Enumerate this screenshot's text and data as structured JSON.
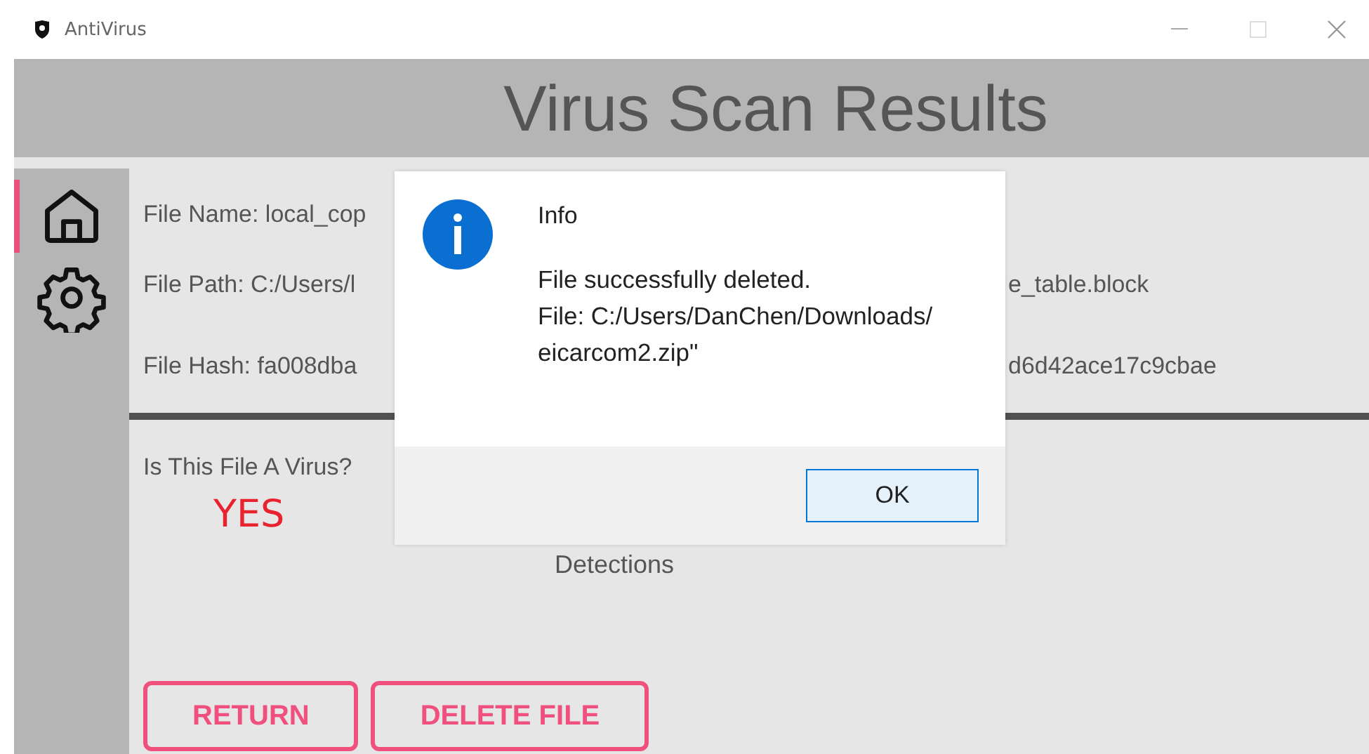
{
  "window": {
    "title": "AntiVirus"
  },
  "header": {
    "title": "Virus Scan Results"
  },
  "sidebar": {
    "items": [
      {
        "kind": "home",
        "selected": true
      },
      {
        "kind": "settings",
        "selected": false
      }
    ]
  },
  "file_info": [
    {
      "label": "File Name:",
      "value_start": "local_cop"
    },
    {
      "label": "File Path:",
      "value_start": "C:/Users/l",
      "value_end": "e_table.block"
    },
    {
      "label": "File Hash:",
      "value_start": "fa008dba",
      "value_end": "d6d42ace17c9cbae"
    }
  ],
  "verdict": {
    "question": "Is This File A Virus?",
    "answer": "YES",
    "is_virus": true
  },
  "detections": {
    "label": "Detections"
  },
  "buttons": [
    "RETURN",
    "DELETE FILE"
  ],
  "dialog": {
    "title": "Info",
    "message_lines": [
      "File successfully deleted.",
      "File: C:/Users/DanChen/Downloads/",
      "eicarcom2.zip\""
    ],
    "button": "OK"
  }
}
